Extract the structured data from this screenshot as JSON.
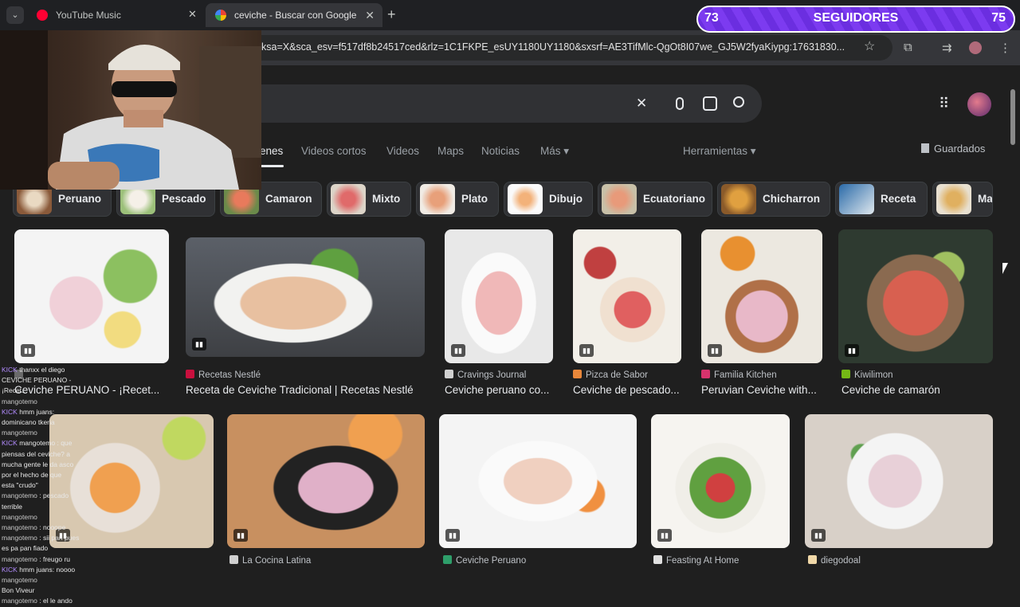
{
  "browser": {
    "tabs": [
      {
        "title": "YouTube Music",
        "color": "#ff0033"
      },
      {
        "title": "ceviche - Buscar con Google",
        "color": "#4285f4"
      }
    ],
    "url": "ksa=X&sca_esv=f517df8b24517ced&rlz=1C1FKPE_esUY1180UY1180&sxsrf=AE3TifMlc-QgOt8I07we_GJ5W2fyaKiypg:17631830..."
  },
  "overlay": {
    "followers_left": "73",
    "followers_label": "SEGUIDORES",
    "followers_right": "75"
  },
  "search": {
    "tabs": [
      "enes",
      "Videos cortos",
      "Videos",
      "Maps",
      "Noticias",
      "Más ▾",
      "Herramientas ▾"
    ],
    "saved_label": "Guardados"
  },
  "chips": [
    "Peruano",
    "Pescado",
    "Camaron",
    "Mixto",
    "Plato",
    "Dibujo",
    "Ecuatoriano",
    "Chicharron",
    "Receta",
    "Ma"
  ],
  "results_row1": [
    {
      "source": "",
      "title": "Ceviche PERUANO - ¡Recet...",
      "icon_color": "#6a6a6a"
    },
    {
      "source": "Recetas Nestlé",
      "title": "Receta de Ceviche Tradicional | Recetas Nestlé",
      "icon_color": "#c8103e"
    },
    {
      "source": "Cravings Journal",
      "title": "Ceviche peruano co...",
      "icon_color": "#d0d0d0"
    },
    {
      "source": "Pizca de Sabor",
      "title": "Ceviche de pescado...",
      "icon_color": "#e8873a"
    },
    {
      "source": "Familia Kitchen",
      "title": "Peruvian Ceviche with...",
      "icon_color": "#d6336c"
    },
    {
      "source": "Kiwilimon",
      "title": "Ceviche de camarón",
      "icon_color": "#74b816"
    }
  ],
  "results_row2": [
    {
      "source": "La Cocina Latina",
      "title": "",
      "icon_color": "#cfcfcf"
    },
    {
      "source": "Ceviche Peruano",
      "title": "",
      "icon_color": "#2e9e6a"
    },
    {
      "source": "Feasting At Home",
      "title": "",
      "icon_color": "#e0e0e0"
    },
    {
      "source": "diegodoal",
      "title": "",
      "icon_color": "#f0d8a8"
    }
  ],
  "chat_lines": [
    {
      "user": "KICK",
      "text": "thanxx el diego "
    },
    {
      "user": "",
      "text": "CEVICHE PERUANO - ¡Recet..."
    },
    {
      "user": "mangotemo",
      "text": ""
    },
    {
      "user": "KICK",
      "text": "hmm juans: dominicano tkeria"
    },
    {
      "user": "mangotemo",
      "text": ""
    },
    {
      "user": "KICK",
      "text": "mangotemo : que piensas del ceviche? a"
    },
    {
      "user": "",
      "text": "mucha gente le da asco por el hecho de que"
    },
    {
      "user": "",
      "text": "esta \"crudo\""
    },
    {
      "user": "mangotemo",
      "text": ": pescado terrible"
    },
    {
      "user": "mangotemo",
      "text": ""
    },
    {
      "user": "mangotemo",
      "text": ": nooope"
    },
    {
      "user": "mangotemo",
      "text": ": sii pan pues es pa pan fiado"
    },
    {
      "user": "mangotemo",
      "text": ": freugo ru"
    },
    {
      "user": "KICK",
      "text": "hmm juans: noooo"
    },
    {
      "user": "mangotemo",
      "text": ""
    },
    {
      "user": "",
      "text": "Bon Viveur"
    },
    {
      "user": "mangotemo",
      "text": ": el le ando"
    }
  ]
}
